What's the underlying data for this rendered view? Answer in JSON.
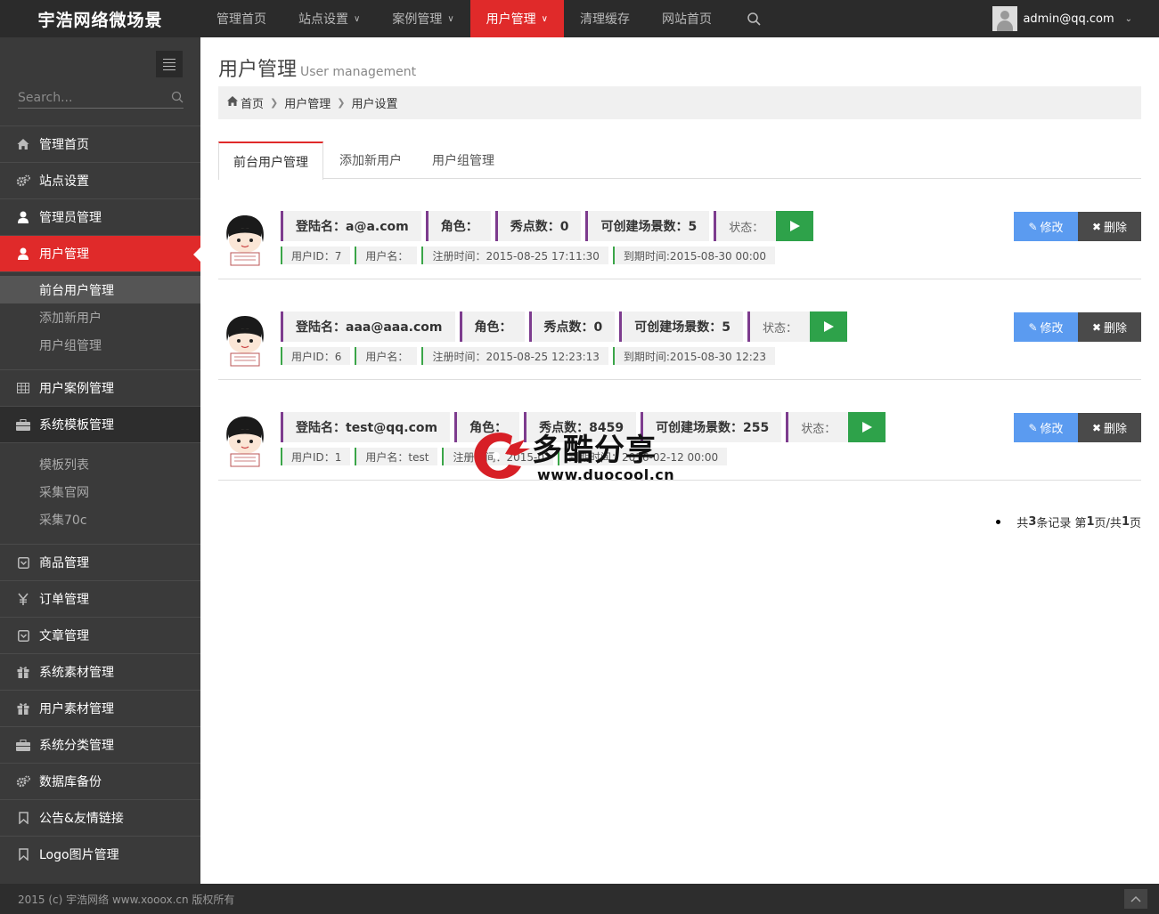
{
  "brand": "宇浩网络微场景",
  "topnav": [
    {
      "label": "管理首页",
      "caret": false,
      "active": false
    },
    {
      "label": "站点设置",
      "caret": true,
      "active": false
    },
    {
      "label": "案例管理",
      "caret": true,
      "active": false
    },
    {
      "label": "用户管理",
      "caret": true,
      "active": true
    },
    {
      "label": "清理缓存",
      "caret": false,
      "active": false
    },
    {
      "label": "网站首页",
      "caret": false,
      "active": false
    }
  ],
  "user": {
    "email": "admin@qq.com"
  },
  "sidebar": {
    "search_placeholder": "Search...",
    "items_top": [
      {
        "label": "管理首页",
        "icon": "home-icon"
      },
      {
        "label": "站点设置",
        "icon": "gears-icon"
      },
      {
        "label": "管理员管理",
        "icon": "user-icon"
      },
      {
        "label": "用户管理",
        "icon": "user-icon"
      }
    ],
    "user_sub": [
      "前台用户管理",
      "添加新用户",
      "用户组管理"
    ],
    "items_mid": [
      {
        "label": "用户案例管理",
        "icon": "table-icon"
      },
      {
        "label": "系统模板管理",
        "icon": "briefcase-icon"
      }
    ],
    "template_sub": [
      "模板列表",
      "采集官网",
      "采集70c"
    ],
    "items_bottom": [
      {
        "label": "商品管理",
        "icon": "square-icon"
      },
      {
        "label": "订单管理",
        "icon": "yen-icon"
      },
      {
        "label": "文章管理",
        "icon": "square-icon"
      },
      {
        "label": "系统素材管理",
        "icon": "gift-icon"
      },
      {
        "label": "用户素材管理",
        "icon": "gift-icon"
      },
      {
        "label": "系统分类管理",
        "icon": "briefcase-icon"
      },
      {
        "label": "数据库备份",
        "icon": "gears-icon"
      },
      {
        "label": "公告&友情链接",
        "icon": "bookmark-icon"
      },
      {
        "label": "Logo图片管理",
        "icon": "bookmark-icon"
      }
    ]
  },
  "page": {
    "title": "用户管理",
    "subtitle": "User management",
    "breadcrumb": [
      "首页",
      "用户管理",
      "用户设置"
    ],
    "tabs": [
      "前台用户管理",
      "添加新用户",
      "用户组管理"
    ]
  },
  "users": [
    {
      "login": "登陆名：a@a.com",
      "role": "角色：",
      "points": "秀点数：0",
      "scenes": "可创建场景数：5",
      "status": "状态：",
      "uid": "用户ID：7",
      "uname": "用户名：",
      "reg": "注册时间：2015-08-25 17:11:30",
      "expire": "到期时间:2015-08-30 00:00"
    },
    {
      "login": "登陆名：aaa@aaa.com",
      "role": "角色：",
      "points": "秀点数：0",
      "scenes": "可创建场景数：5",
      "status": "状态：",
      "uid": "用户ID：6",
      "uname": "用户名：",
      "reg": "注册时间：2015-08-25 12:23:13",
      "expire": "到期时间:2015-08-30 12:23"
    },
    {
      "login": "登陆名：test@qq.com",
      "role": "角色：",
      "points": "秀点数：8459",
      "scenes": "可创建场景数：255",
      "status": "状态：",
      "uid": "用户ID：1",
      "uname": "用户名：test",
      "reg": "注册时间：2015-0",
      "expire": "到期时间：2016-02-12 00:00"
    }
  ],
  "actions": {
    "edit": "修改",
    "delete": "删除"
  },
  "pager": {
    "prefix": "共",
    "total": "3",
    "mid1": "条记录 第",
    "page": "1",
    "mid2": "页/共",
    "pages": "1",
    "suffix": "页"
  },
  "watermark": {
    "text": "多酷分享",
    "url": "www.duocool.cn"
  },
  "footer": "2015 (c) 宇浩网络 www.xooox.cn 版权所有"
}
